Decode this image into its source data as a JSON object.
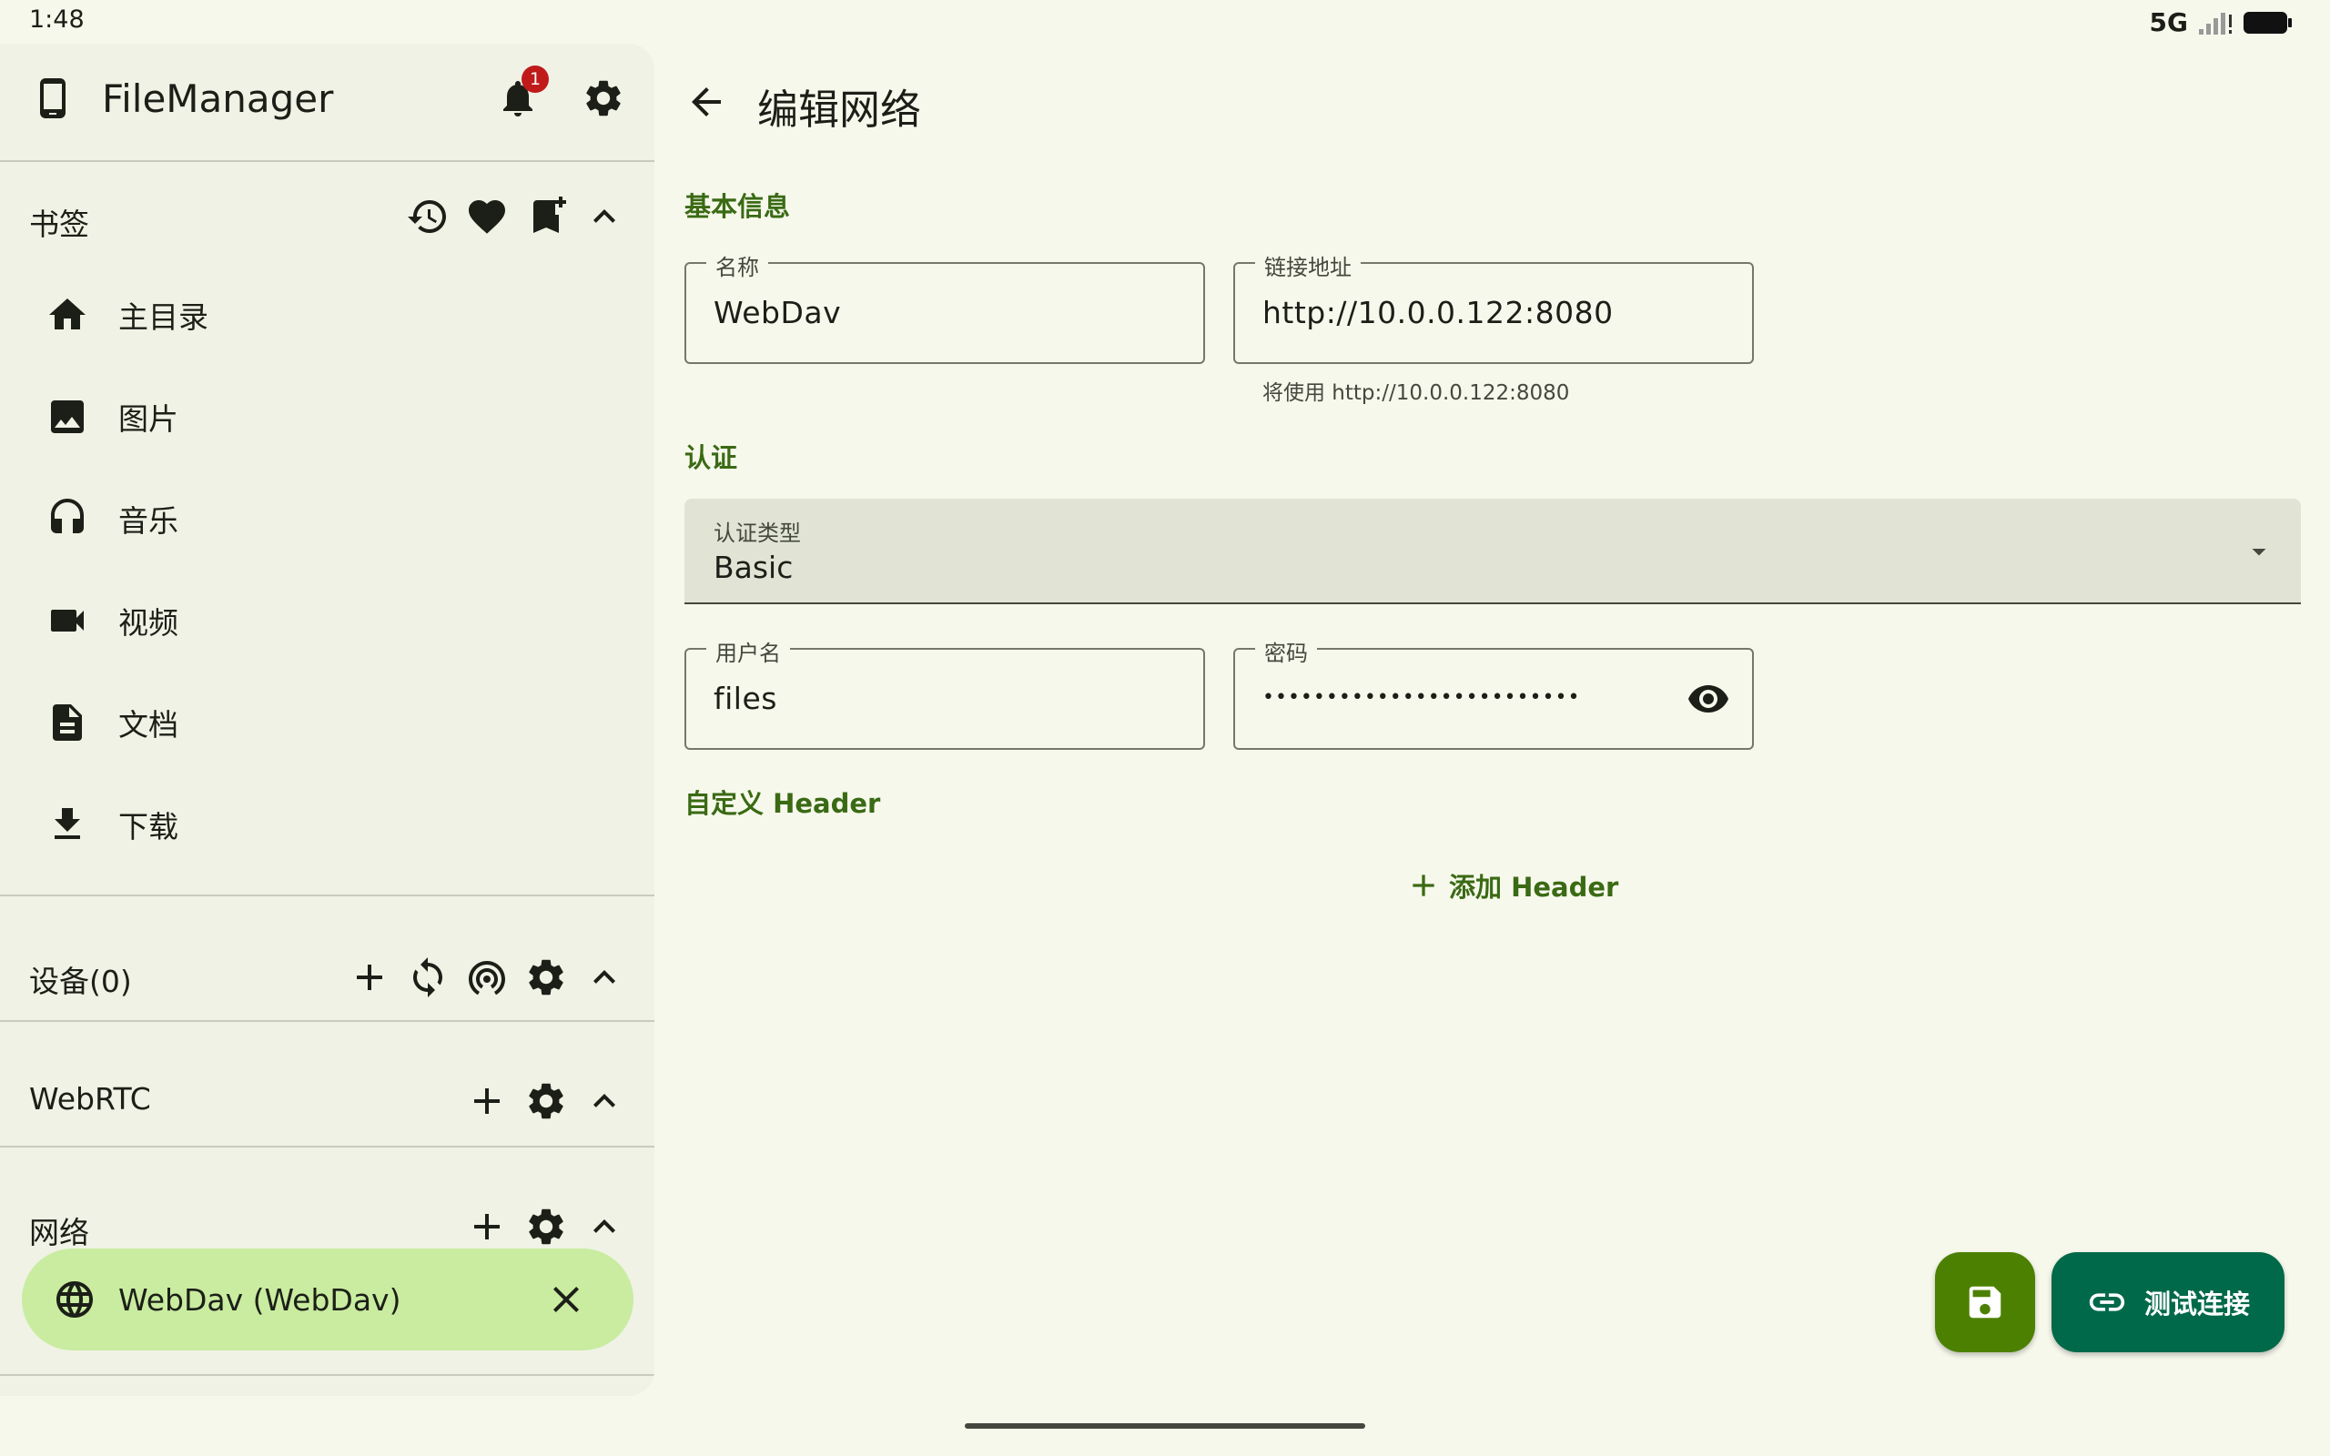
{
  "status": {
    "time": "1:48",
    "network": "5G"
  },
  "sidebar": {
    "app_title": "FileManager",
    "notification_count": "1",
    "bookmarks": {
      "title": "书签",
      "items": [
        {
          "label": "主目录",
          "icon": "home-icon"
        },
        {
          "label": "图片",
          "icon": "image-icon"
        },
        {
          "label": "音乐",
          "icon": "headphones-icon"
        },
        {
          "label": "视频",
          "icon": "videocam-icon"
        },
        {
          "label": "文档",
          "icon": "document-icon"
        },
        {
          "label": "下载",
          "icon": "download-icon"
        }
      ]
    },
    "devices": {
      "title": "设备(0)"
    },
    "webrtc": {
      "title": "WebRTC"
    },
    "network": {
      "title": "网络",
      "active_item": "WebDav (WebDav)"
    }
  },
  "main": {
    "title": "编辑网络",
    "basic_section": "基本信息",
    "name_field": {
      "label": "名称",
      "value": "WebDav"
    },
    "url_field": {
      "label": "链接地址",
      "value": "http://10.0.0.122:8080",
      "helper": "将使用 http://10.0.0.122:8080"
    },
    "auth_section": "认证",
    "auth_type": {
      "label": "认证类型",
      "value": "Basic"
    },
    "username_field": {
      "label": "用户名",
      "value": "files"
    },
    "password_field": {
      "label": "密码",
      "value": "•••••••••••••••••••••••••"
    },
    "custom_header_section": "自定义 Header",
    "add_header_label": "添加 Header",
    "test_button_label": "测试连接"
  },
  "colors": {
    "accent": "#3a6a14",
    "save_fab": "#4c8000",
    "test_fab": "#00694a",
    "active_pill": "#c9eca0"
  }
}
